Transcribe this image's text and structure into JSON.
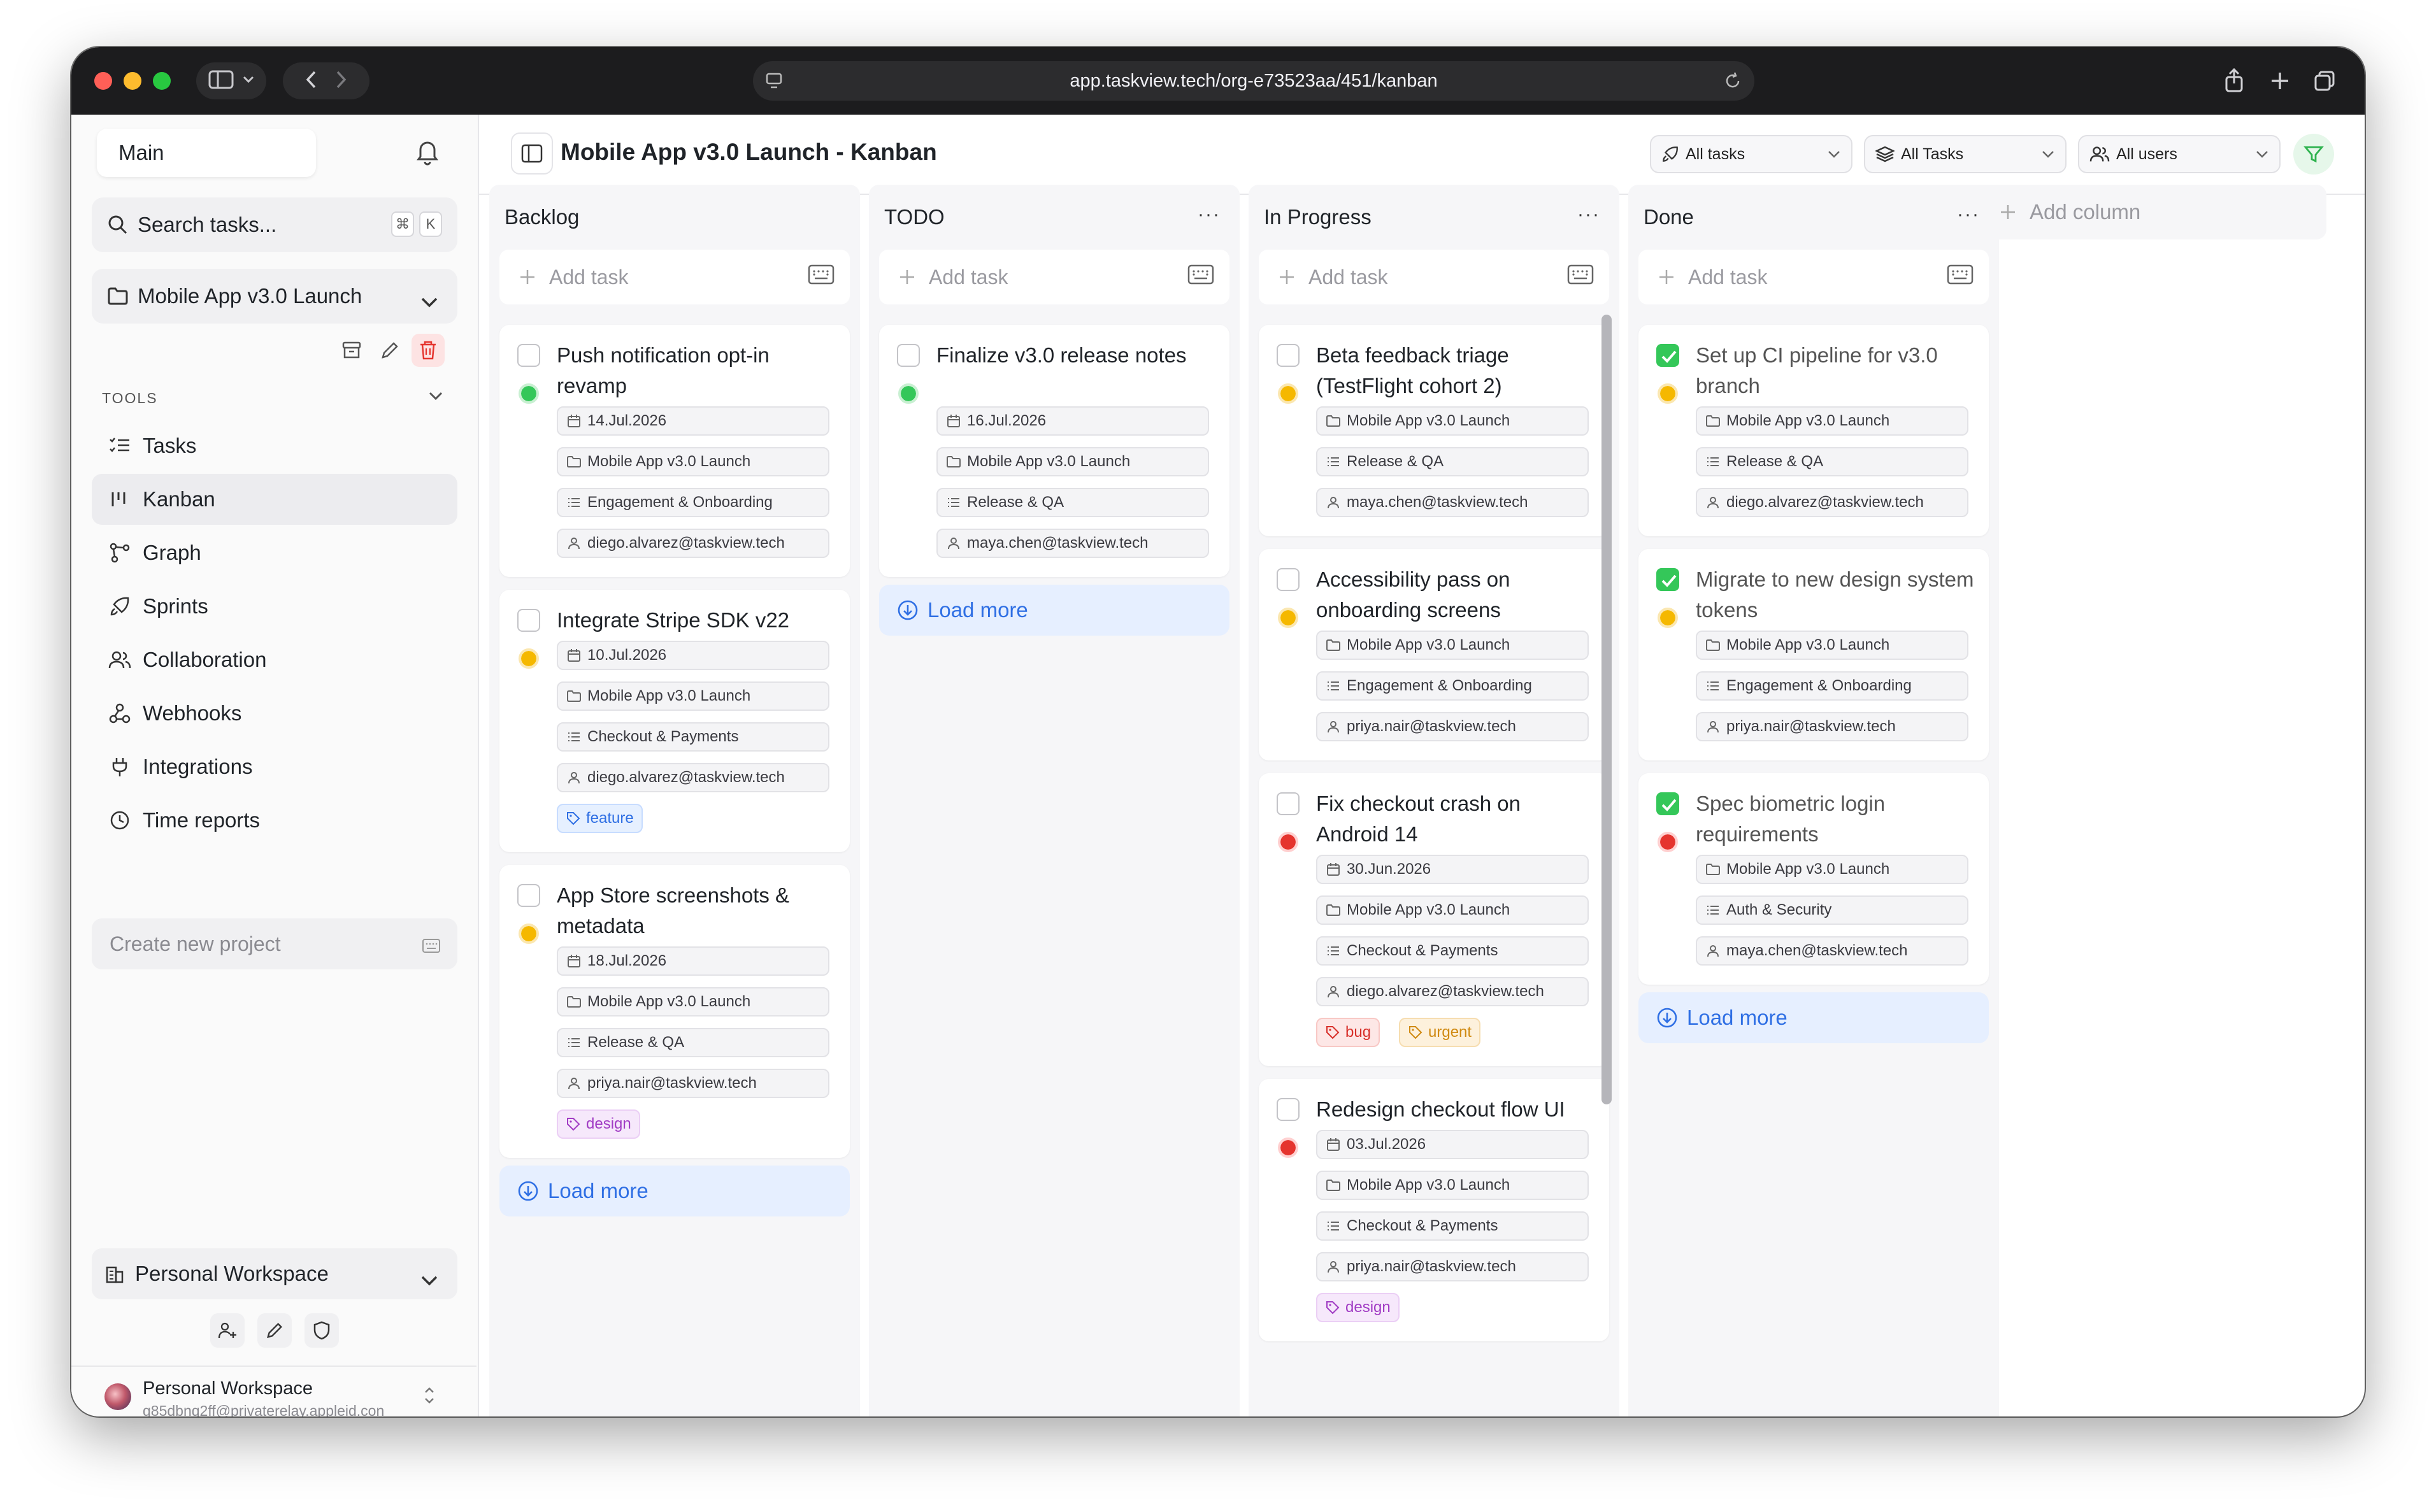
{
  "browser": {
    "url": "app.taskview.tech/org-e73523aa/451/kanban",
    "traffic_lights": [
      "#ff5f57",
      "#febc2e",
      "#28c840"
    ]
  },
  "sidebar": {
    "workspace_select": "Main",
    "search": {
      "placeholder": "Search tasks...",
      "shortcut_mod": "⌘",
      "shortcut_key": "K"
    },
    "project": "Mobile App v3.0 Launch",
    "tools_label": "TOOLS",
    "nav": [
      {
        "label": "Tasks",
        "icon": "tasks-icon"
      },
      {
        "label": "Kanban",
        "icon": "kanban-icon",
        "active": true
      },
      {
        "label": "Graph",
        "icon": "graph-icon"
      },
      {
        "label": "Sprints",
        "icon": "rocket-icon"
      },
      {
        "label": "Collaboration",
        "icon": "users-icon"
      },
      {
        "label": "Webhooks",
        "icon": "webhook-icon"
      },
      {
        "label": "Integrations",
        "icon": "plug-icon"
      },
      {
        "label": "Time reports",
        "icon": "clock-icon"
      }
    ],
    "create_project_placeholder": "Create new project",
    "personal_workspace": "Personal Workspace",
    "user": {
      "name": "Personal Workspace",
      "email": "g85dbnq2ff@privaterelay.appleid.con"
    }
  },
  "header": {
    "title": "Mobile App v3.0 Launch - Kanban",
    "filters": [
      "All tasks",
      "All Tasks",
      "All users"
    ],
    "filter_accent": "#34c759"
  },
  "board": {
    "add_task_label": "Add task",
    "load_more_label": "Load more",
    "add_column_label": "Add column",
    "columns": [
      {
        "name": "Backlog",
        "cards": [
          {
            "title": "Push notification opt-in revamp",
            "status": "green",
            "done": false,
            "date": "14.Jul.2026",
            "project": "Mobile App v3.0 Launch",
            "list": "Engagement & Onboarding",
            "assignee": "diego.alvarez@taskview.tech",
            "tags": []
          },
          {
            "title": "Integrate Stripe SDK v22",
            "status": "yellow",
            "done": false,
            "date": "10.Jul.2026",
            "project": "Mobile App v3.0 Launch",
            "list": "Checkout & Payments",
            "assignee": "diego.alvarez@taskview.tech",
            "tags": [
              "feature"
            ]
          },
          {
            "title": "App Store screenshots & metadata",
            "status": "yellow",
            "done": false,
            "date": "18.Jul.2026",
            "project": "Mobile App v3.0 Launch",
            "list": "Release & QA",
            "assignee": "priya.nair@taskview.tech",
            "tags": [
              "design"
            ]
          }
        ]
      },
      {
        "name": "TODO",
        "cards": [
          {
            "title": "Finalize v3.0 release notes",
            "status": "green",
            "done": false,
            "date": "16.Jul.2026",
            "project": "Mobile App v3.0 Launch",
            "list": "Release & QA",
            "assignee": "maya.chen@taskview.tech",
            "tags": []
          }
        ]
      },
      {
        "name": "In Progress",
        "cards": [
          {
            "title": "Beta feedback triage (TestFlight cohort 2)",
            "status": "yellow",
            "done": false,
            "project": "Mobile App v3.0 Launch",
            "list": "Release & QA",
            "assignee": "maya.chen@taskview.tech",
            "tags": []
          },
          {
            "title": "Accessibility pass on onboarding screens",
            "status": "yellow",
            "done": false,
            "project": "Mobile App v3.0 Launch",
            "list": "Engagement & Onboarding",
            "assignee": "priya.nair@taskview.tech",
            "tags": []
          },
          {
            "title": "Fix checkout crash on Android 14",
            "status": "red",
            "done": false,
            "date": "30.Jun.2026",
            "project": "Mobile App v3.0 Launch",
            "list": "Checkout & Payments",
            "assignee": "diego.alvarez@taskview.tech",
            "tags": [
              "bug",
              "urgent"
            ]
          },
          {
            "title": "Redesign checkout flow UI",
            "status": "red",
            "done": false,
            "date": "03.Jul.2026",
            "project": "Mobile App v3.0 Launch",
            "list": "Checkout & Payments",
            "assignee": "priya.nair@taskview.tech",
            "tags": [
              "design"
            ]
          }
        ]
      },
      {
        "name": "Done",
        "cards": [
          {
            "title": "Set up CI pipeline for v3.0 branch",
            "status": "yellow",
            "done": true,
            "project": "Mobile App v3.0 Launch",
            "list": "Release & QA",
            "assignee": "diego.alvarez@taskview.tech",
            "tags": []
          },
          {
            "title": "Migrate to new design system tokens",
            "status": "yellow",
            "done": true,
            "project": "Mobile App v3.0 Launch",
            "list": "Engagement & Onboarding",
            "assignee": "priya.nair@taskview.tech",
            "tags": []
          },
          {
            "title": "Spec biometric login requirements",
            "status": "red",
            "done": true,
            "project": "Mobile App v3.0 Launch",
            "list": "Auth & Security",
            "assignee": "maya.chen@taskview.tech",
            "tags": []
          }
        ]
      }
    ]
  }
}
